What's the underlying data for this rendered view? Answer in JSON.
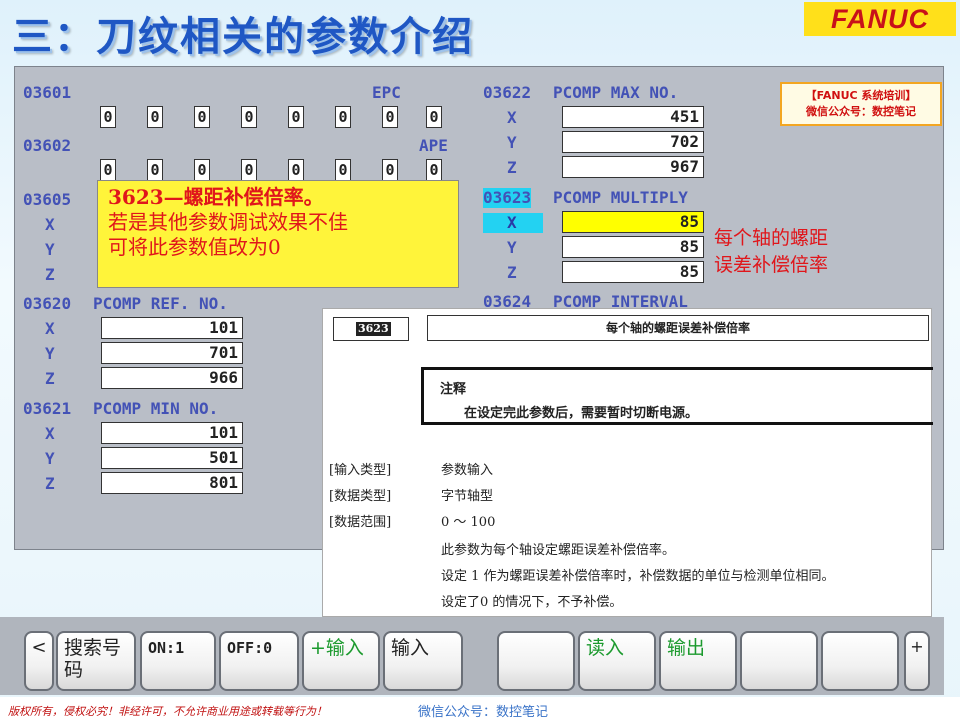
{
  "slide": {
    "title": "三：刀纹相关的参数介绍",
    "logo": "FANUC"
  },
  "params": {
    "p3601": {
      "num": "03601",
      "label": "EPC",
      "bits": [
        "0",
        "0",
        "0",
        "0",
        "0",
        "0",
        "0",
        "0"
      ]
    },
    "p3602": {
      "num": "03602",
      "label": "APE",
      "bits": [
        "0",
        "0",
        "0",
        "0",
        "0",
        "0",
        "0",
        "0"
      ]
    },
    "p3605": {
      "num": "03605",
      "axes": [
        "X",
        "Y",
        "Z"
      ]
    },
    "p3620": {
      "num": "03620",
      "label": "PCOMP REF. NO.",
      "axes": [
        "X",
        "Y",
        "Z"
      ],
      "values": [
        "101",
        "701",
        "966"
      ]
    },
    "p3621": {
      "num": "03621",
      "label": "PCOMP MIN NO.",
      "axes": [
        "X",
        "Y",
        "Z"
      ],
      "values": [
        "101",
        "501",
        "801"
      ]
    },
    "p3622": {
      "num": "03622",
      "label": "PCOMP MAX NO.",
      "axes": [
        "X",
        "Y",
        "Z"
      ],
      "values": [
        "451",
        "702",
        "967"
      ]
    },
    "p3623": {
      "num": "03623",
      "label": "PCOMP MULTIPLY",
      "axes": [
        "X",
        "Y",
        "Z"
      ],
      "values": [
        "85",
        "85",
        "85"
      ]
    },
    "p3624": {
      "num": "03624",
      "label": "PCOMP INTERVAL"
    }
  },
  "note": {
    "line1": "3623—螺距补偿倍率。",
    "line2": "若是其他参数调试效果不佳",
    "line3": "可将此参数值改为0"
  },
  "side_note": {
    "line1": "每个轴的螺距",
    "line2": "误差补偿倍率"
  },
  "training": {
    "line1": "【FANUC 系统培训】",
    "line2": "微信公众号：数控笔记"
  },
  "manual": {
    "param_no": "3623",
    "header": "每个轴的螺距误差补偿倍率",
    "note_title": "注释",
    "note_text": "在设定完此参数后，需要暂时切断电源。",
    "input_type_label": "[输入类型]",
    "input_type": "参数输入",
    "data_type_label": "[数据类型]",
    "data_type": "字节轴型",
    "data_range_label": "[数据范围]",
    "data_range": "0 ～ 100",
    "desc1": "此参数为每个轴设定螺距误差补偿倍率。",
    "desc2": "设定 1 作为螺距误差补偿倍率时，补偿数据的单位与检测单位相同。",
    "desc3": "设定了0 的情况下，不予补偿。"
  },
  "softkeys": {
    "left_arrow": "<",
    "search": "搜索号码",
    "on": "ON:1",
    "off": "OFF:0",
    "plus_input": "+输入",
    "input": "输入",
    "read": "读入",
    "output": "输出",
    "plus": "+"
  },
  "footer": {
    "left": "版权所有，侵权必究！非经许可，不允许商业用途或转载等行为！",
    "right": "微信公众号：数控笔记"
  }
}
